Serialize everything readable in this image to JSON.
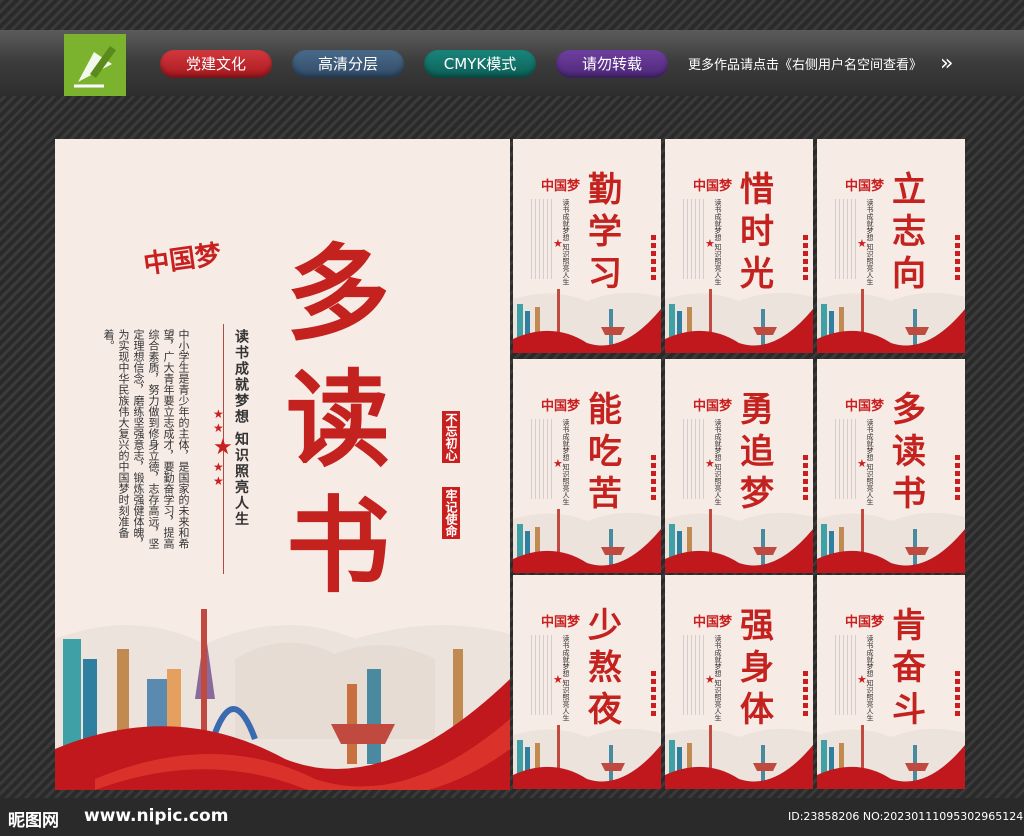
{
  "topbar": {
    "tags": [
      "党建文化",
      "高清分层",
      "CMYK模式",
      "请勿转载"
    ],
    "more": "更多作品请点击《右侧用户名空间查看》",
    "arrows": "»"
  },
  "main_poster": {
    "title": "多读书",
    "slogan": "读书成就梦想  知识照亮人生",
    "body": "中小学生是青少年的主体，是国家的未来和希望，广大青年要立志成才，要勤奋学习，提高综合素质，努力做到修身立德，志存高远，坚定理想信念，磨练坚强意志，锻炼强健体魄，为实现中华民族伟大复兴的中国梦时刻准备着。",
    "seal_1": "不忘初心",
    "seal_2": "牢记使命",
    "calligraphy": "中国梦"
  },
  "mini_posters": [
    {
      "title": "勤学习"
    },
    {
      "title": "惜时光"
    },
    {
      "title": "立志向"
    },
    {
      "title": "能吃苦"
    },
    {
      "title": "勇追梦"
    },
    {
      "title": "多读书"
    },
    {
      "title": "少熬夜"
    },
    {
      "title": "强身体"
    },
    {
      "title": "肯奋斗"
    }
  ],
  "mini_common": {
    "sub": "读书成就梦想  知识照亮人生",
    "calligraphy": "中国梦"
  },
  "footer": {
    "site_name": "昵图网",
    "site_url": "www.nipic.com",
    "id_text": "ID:23858206 NO:20230111095302965124"
  },
  "colors": {
    "accent": "#c3221e",
    "poster_bg": "#f7ebe6"
  }
}
